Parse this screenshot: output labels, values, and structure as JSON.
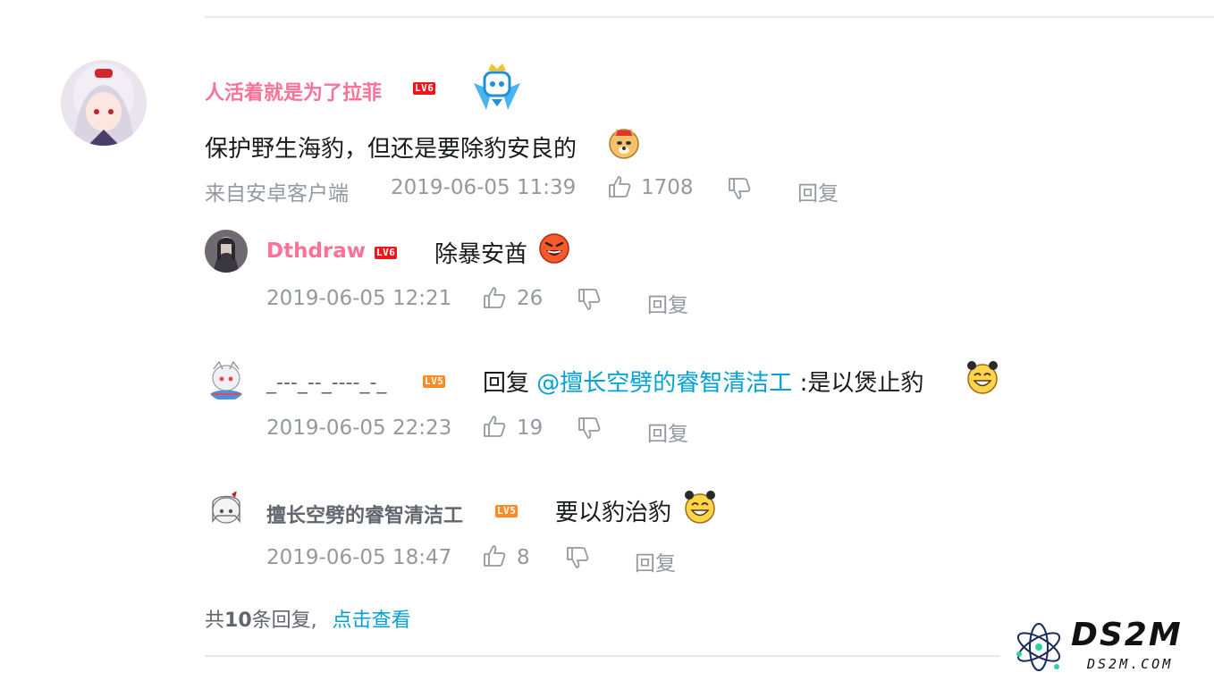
{
  "main_comment": {
    "username": "人活着就是为了拉菲",
    "level": "LV6",
    "content": "保护野生海豹，但还是要除豹安良的",
    "source": "来自安卓客户端",
    "time": "2019-06-05 11:39",
    "likes": "1708",
    "reply_label": "回复"
  },
  "replies": [
    {
      "username": "Dthdraw",
      "level": "LV6",
      "content": "除暴安酋",
      "time": "2019-06-05 12:21",
      "likes": "26",
      "reply_label": "回复"
    },
    {
      "username": "_---_--_----_-_",
      "level": "LV5",
      "reply_prefix": "回复",
      "mention": "@擅长空劈的睿智清洁工",
      "content": ":是以煲止豹",
      "time": "2019-06-05 22:23",
      "likes": "19",
      "reply_label": "回复"
    },
    {
      "username": "擅长空劈的睿智清洁工",
      "level": "LV5",
      "content": "要以豹治豹",
      "time": "2019-06-05 18:47",
      "likes": "8",
      "reply_label": "回复"
    }
  ],
  "footer": {
    "total_prefix": "共",
    "total_count": "10",
    "total_suffix": "条回复,",
    "view_link": "点击查看"
  },
  "watermark": {
    "brand": "DS2M",
    "url": "DS2M.COM"
  },
  "colors": {
    "vip_name": "#fb7299",
    "mention": "#00a1d6",
    "meta": "#9499a0",
    "lv6": "#f0151b",
    "lv5": "#ff8a26"
  }
}
